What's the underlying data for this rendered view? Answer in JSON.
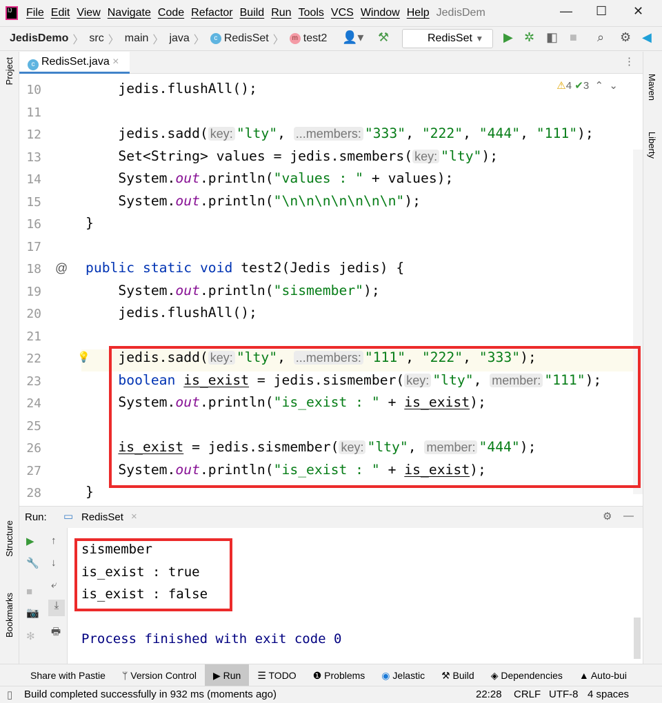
{
  "menu": {
    "items": [
      "File",
      "Edit",
      "View",
      "Navigate",
      "Code",
      "Refactor",
      "Build",
      "Run",
      "Tools",
      "VCS",
      "Window",
      "Help"
    ],
    "window_title": "JedisDem"
  },
  "nav": {
    "project": "JedisDemo",
    "crumbs": [
      "src",
      "main",
      "java"
    ],
    "class": "RedisSet",
    "method": "test2",
    "run_config": "RedisSet"
  },
  "editor": {
    "tab": "RedisSet.java",
    "warnings": "4",
    "weak_warnings": "3",
    "lines": [
      {
        "n": "10",
        "t": [
          [
            "p",
            "    jedis.flushAll();"
          ]
        ]
      },
      {
        "n": "11",
        "t": []
      },
      {
        "n": "12",
        "t": [
          [
            "p",
            "    jedis.sadd("
          ],
          [
            "h",
            "key:"
          ],
          [
            "s",
            "\"lty\""
          ],
          [
            "p",
            ", "
          ],
          [
            "h",
            "...members:"
          ],
          [
            "s",
            "\"333\""
          ],
          [
            "p",
            ", "
          ],
          [
            "s",
            "\"222\""
          ],
          [
            "p",
            ", "
          ],
          [
            "s",
            "\"444\""
          ],
          [
            "p",
            ", "
          ],
          [
            "s",
            "\"111\""
          ],
          [
            "p",
            ");"
          ]
        ]
      },
      {
        "n": "13",
        "t": [
          [
            "p",
            "    Set<String> values = jedis.smembers("
          ],
          [
            "h",
            "key:"
          ],
          [
            "s",
            "\"lty\""
          ],
          [
            "p",
            ");"
          ]
        ]
      },
      {
        "n": "14",
        "t": [
          [
            "p",
            "    System."
          ],
          [
            "f",
            "out"
          ],
          [
            "p",
            ".println("
          ],
          [
            "s",
            "\"values : \""
          ],
          [
            "p",
            " + values);"
          ]
        ]
      },
      {
        "n": "15",
        "t": [
          [
            "p",
            "    System."
          ],
          [
            "f",
            "out"
          ],
          [
            "p",
            ".println("
          ],
          [
            "s",
            "\"\\n\\n\\n\\n\\n\\n\\n\""
          ],
          [
            "p",
            ");"
          ]
        ]
      },
      {
        "n": "16",
        "t": [
          [
            "p",
            "}"
          ]
        ]
      },
      {
        "n": "17",
        "t": []
      },
      {
        "n": "18",
        "t": [
          [
            "k",
            "public static void "
          ],
          [
            "p",
            "test2(Jedis jedis) {"
          ]
        ]
      },
      {
        "n": "19",
        "t": [
          [
            "p",
            "    System."
          ],
          [
            "f",
            "out"
          ],
          [
            "p",
            ".println("
          ],
          [
            "s",
            "\"sismember\""
          ],
          [
            "p",
            ");"
          ]
        ]
      },
      {
        "n": "20",
        "t": [
          [
            "p",
            "    jedis.flushAll();"
          ]
        ]
      },
      {
        "n": "21",
        "t": []
      },
      {
        "n": "22",
        "t": [
          [
            "p",
            "    jedis.sadd("
          ],
          [
            "h",
            "key:"
          ],
          [
            "s",
            "\"lty\""
          ],
          [
            "p",
            ", "
          ],
          [
            "h",
            "...members:"
          ],
          [
            "s",
            "\"111\""
          ],
          [
            "p",
            ", "
          ],
          [
            "s",
            "\"222\""
          ],
          [
            "p",
            ", "
          ],
          [
            "s",
            "\"333\""
          ],
          [
            "p",
            ");"
          ]
        ]
      },
      {
        "n": "23",
        "t": [
          [
            "p",
            "    "
          ],
          [
            "k",
            "boolean "
          ],
          [
            "u",
            "is_exist"
          ],
          [
            "p",
            " = jedis.sismember("
          ],
          [
            "h",
            "key:"
          ],
          [
            "s",
            "\"lty\""
          ],
          [
            "p",
            ", "
          ],
          [
            "h",
            "member:"
          ],
          [
            "s",
            "\"111\""
          ],
          [
            "p",
            ");"
          ]
        ]
      },
      {
        "n": "24",
        "t": [
          [
            "p",
            "    System."
          ],
          [
            "f",
            "out"
          ],
          [
            "p",
            ".println("
          ],
          [
            "s",
            "\"is_exist : \""
          ],
          [
            "p",
            " + "
          ],
          [
            "u",
            "is_exist"
          ],
          [
            "p",
            ");"
          ]
        ]
      },
      {
        "n": "25",
        "t": []
      },
      {
        "n": "26",
        "t": [
          [
            "p",
            "    "
          ],
          [
            "u",
            "is_exist"
          ],
          [
            "p",
            " = jedis.sismember("
          ],
          [
            "h",
            "key:"
          ],
          [
            "s",
            "\"lty\""
          ],
          [
            "p",
            ", "
          ],
          [
            "h",
            "member:"
          ],
          [
            "s",
            "\"444\""
          ],
          [
            "p",
            ");"
          ]
        ]
      },
      {
        "n": "27",
        "t": [
          [
            "p",
            "    System."
          ],
          [
            "f",
            "out"
          ],
          [
            "p",
            ".println("
          ],
          [
            "s",
            "\"is_exist : \""
          ],
          [
            "p",
            " + "
          ],
          [
            "u",
            "is_exist"
          ],
          [
            "p",
            ");"
          ]
        ]
      },
      {
        "n": "28",
        "t": [
          [
            "p",
            "}"
          ]
        ]
      }
    ]
  },
  "run": {
    "label": "Run:",
    "tab": "RedisSet",
    "output": [
      "sismember",
      "is_exist : true",
      "is_exist : false"
    ],
    "exit": "Process finished with exit code 0"
  },
  "side": {
    "project": "Project",
    "structure": "Structure",
    "bookmarks": "Bookmarks",
    "maven": "Maven",
    "liberty": "Liberty"
  },
  "bottom_tabs": [
    "Share with Pastie",
    "Version Control",
    "Run",
    "TODO",
    "Problems",
    "Jelastic",
    "Build",
    "Dependencies",
    "Auto-bui"
  ],
  "status": {
    "message": "Build completed successfully in 932 ms (moments ago)",
    "position": "22:28",
    "line_sep": "CRLF",
    "encoding": "UTF-8",
    "indent": "4 spaces"
  },
  "colors": {
    "highlight_box": "#ec2b2b",
    "keyword": "#0033b3",
    "string": "#067d17",
    "field": "#871094"
  }
}
